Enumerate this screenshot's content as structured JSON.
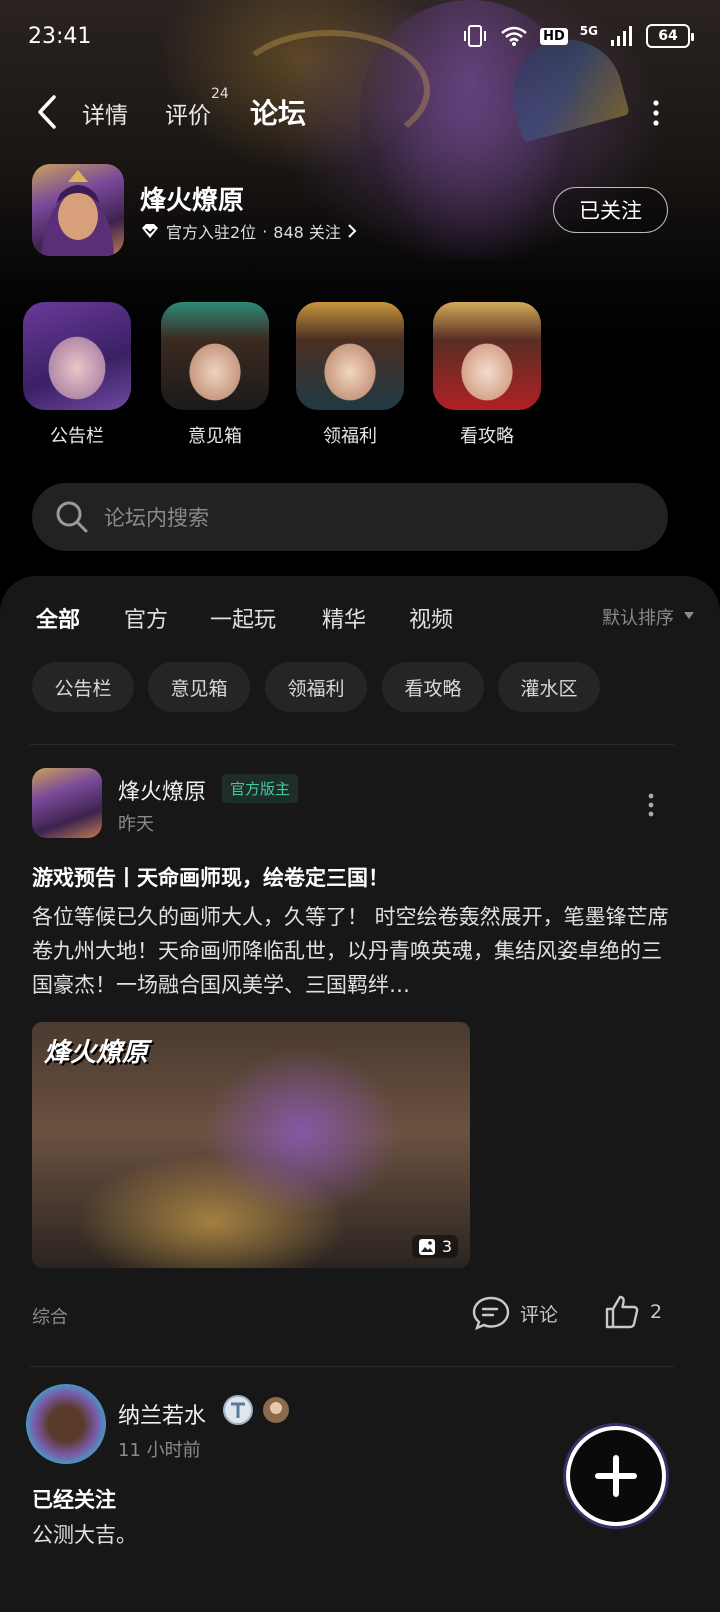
{
  "status_bar": {
    "time": "23:41",
    "network": "5G",
    "hd": "HD",
    "battery": "64"
  },
  "nav": {
    "tabs": [
      {
        "label": "详情",
        "active": false
      },
      {
        "label": "评价",
        "badge": "24",
        "active": false
      },
      {
        "label": "论坛",
        "active": true
      }
    ]
  },
  "forum": {
    "name": "烽火燎原",
    "meta_official": "官方入驻2位",
    "meta_sep": "·",
    "meta_followers": "848 关注",
    "follow_button": "已关注"
  },
  "shortcuts": [
    {
      "label": "公告栏"
    },
    {
      "label": "意见箱"
    },
    {
      "label": "领福利"
    },
    {
      "label": "看攻略"
    }
  ],
  "search": {
    "placeholder": "论坛内搜索"
  },
  "feed_tabs": [
    {
      "label": "全部",
      "active": true
    },
    {
      "label": "官方",
      "active": false
    },
    {
      "label": "一起玩",
      "active": false
    },
    {
      "label": "精华",
      "active": false
    },
    {
      "label": "视频",
      "active": false
    }
  ],
  "sort": {
    "label": "默认排序"
  },
  "chips": [
    "公告栏",
    "意见箱",
    "领福利",
    "看攻略",
    "灌水区"
  ],
  "posts": [
    {
      "author": "烽火燎原",
      "badge": "官方版主",
      "time": "昨天",
      "title": "游戏预告丨天命画师现，绘卷定三国！",
      "body": "各位等候已久的画师大人，久等了！ 时空绘卷轰然展开，笔墨锋芒席卷九州大地！天命画师降临乱世，以丹青唤英魂，集结风姿卓绝的三国豪杰！一场融合国风美学、三国羁绊…",
      "image_logo": "烽火燎原",
      "image_count": "3",
      "tag": "综合",
      "comment_label": "评论",
      "like_count": "2"
    },
    {
      "author": "纳兰若水",
      "time": "11 小时前",
      "title": "已经关注",
      "body": "公测大吉。"
    }
  ],
  "colors": {
    "accent": "#16c6a4",
    "badge_text": "#3fc9a3",
    "feed_bg": "#171717"
  }
}
